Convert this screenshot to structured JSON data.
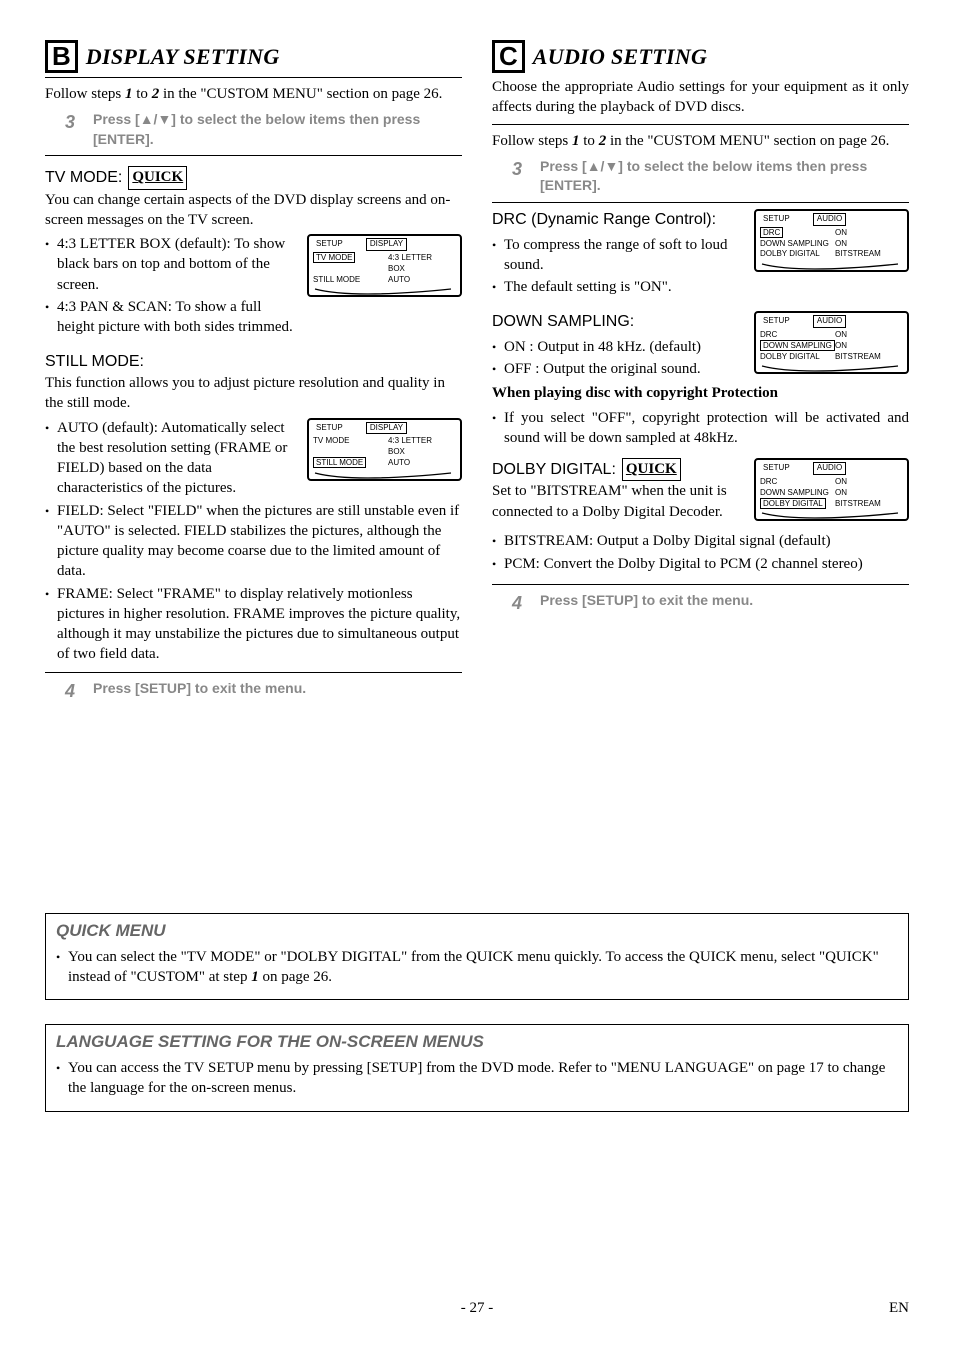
{
  "sections": {
    "b": {
      "letter": "B",
      "title": "DISPLAY SETTING"
    },
    "c": {
      "letter": "C",
      "title": "AUDIO SETTING"
    }
  },
  "common": {
    "follow_pre": "Follow steps ",
    "one": "1",
    "to": " to ",
    "two": "2",
    "follow_post": " in the \"CUSTOM MENU\" section on page 26.",
    "step3_num": "3",
    "step3_text": "Press [▲/▼] to select the below items then press [ENTER].",
    "step4_num": "4",
    "step4_text": "Press [SETUP] to exit the menu.",
    "quick_tag": "QUICK"
  },
  "display": {
    "tvmode_label": "TV MODE:",
    "tvmode_desc": "You can change certain aspects of the DVD display screens and on-screen messages on the TV screen.",
    "tv_items": [
      "4:3 LETTER BOX (default): To show black bars on top and bottom of the screen.",
      "4:3 PAN & SCAN: To show a full height picture with both sides trimmed."
    ],
    "still_label": "STILL MODE:",
    "still_desc": "This function allows you to adjust picture resolution and quality in the still mode.",
    "still_items": [
      "AUTO (default): Automatically select the best resolution setting (FRAME or FIELD) based on the data characteristics of the pictures.",
      "FIELD: Select \"FIELD\" when the pictures are still unstable even if \"AUTO\" is selected. FIELD stabilizes the pictures, although the picture quality may become coarse due to the limited amount of data.",
      "FRAME: Select \"FRAME\" to display relatively motionless pictures in higher resolution. FRAME improves the picture quality, although it may unstabilize the pictures due to simultaneous output of two field data."
    ],
    "menu1": {
      "tab1": "SETUP",
      "tab2": "DISPLAY",
      "r1l": "TV MODE",
      "r1r": "4:3 LETTER BOX",
      "r2l": "STILL MODE",
      "r2r": "AUTO"
    },
    "menu2": {
      "tab1": "SETUP",
      "tab2": "DISPLAY",
      "r1l": "TV MODE",
      "r1r": "4:3 LETTER BOX",
      "r2l": "STILL MODE",
      "r2r": "AUTO"
    }
  },
  "audio": {
    "intro": "Choose the appropriate Audio settings for your equipment as it only affects during the playback of DVD discs.",
    "drc_label": "DRC (Dynamic Range Control):",
    "drc_items": [
      "To compress the range of soft to loud sound.",
      "The default setting is \"ON\"."
    ],
    "down_label": "DOWN SAMPLING:",
    "down_items": [
      "ON : Output in 48 kHz. (default)",
      "OFF : Output the original sound."
    ],
    "down_bold": "When playing disc with copyright Protection",
    "down_note": "If you select \"OFF\", copyright protection will be activated and sound will be down sampled at 48kHz.",
    "dolby_label": "DOLBY DIGITAL:",
    "dolby_desc": "Set to \"BITSTREAM\" when the unit is connected to a Dolby Digital Decoder.",
    "dolby_items": [
      "BITSTREAM: Output a Dolby Digital signal (default)",
      "PCM: Convert the Dolby Digital to PCM (2 channel stereo)"
    ],
    "menu_drc": {
      "tab1": "SETUP",
      "tab2": "AUDIO",
      "r1l": "DRC",
      "r1r": "ON",
      "r2l": "DOWN SAMPLING",
      "r2r": "ON",
      "r3l": "DOLBY DIGITAL",
      "r3r": "BITSTREAM"
    },
    "menu_down": {
      "tab1": "SETUP",
      "tab2": "AUDIO",
      "r1l": "DRC",
      "r1r": "ON",
      "r2l": "DOWN SAMPLING",
      "r2r": "ON",
      "r3l": "DOLBY DIGITAL",
      "r3r": "BITSTREAM"
    },
    "menu_dolby": {
      "tab1": "SETUP",
      "tab2": "AUDIO",
      "r1l": "DRC",
      "r1r": "ON",
      "r2l": "DOWN SAMPLING",
      "r2r": "ON",
      "r3l": "DOLBY DIGITAL",
      "r3r": "BITSTREAM"
    }
  },
  "quick_menu": {
    "title": "QUICK MENU",
    "text_pre": "You can select the \"TV MODE\" or \"DOLBY DIGITAL\" from the QUICK menu quickly. To access the QUICK menu, select \"QUICK\" instead of \"CUSTOM\" at step ",
    "num": "1",
    "text_post": " on page 26."
  },
  "lang_menu": {
    "title": "LANGUAGE SETTING FOR THE ON-SCREEN MENUS",
    "text": "You can access the TV SETUP menu by pressing [SETUP] from the DVD mode. Refer to \"MENU LANGUAGE\" on page 17 to change the language for the on-screen menus."
  },
  "footer": {
    "page": "- 27 -",
    "lang": "EN"
  }
}
